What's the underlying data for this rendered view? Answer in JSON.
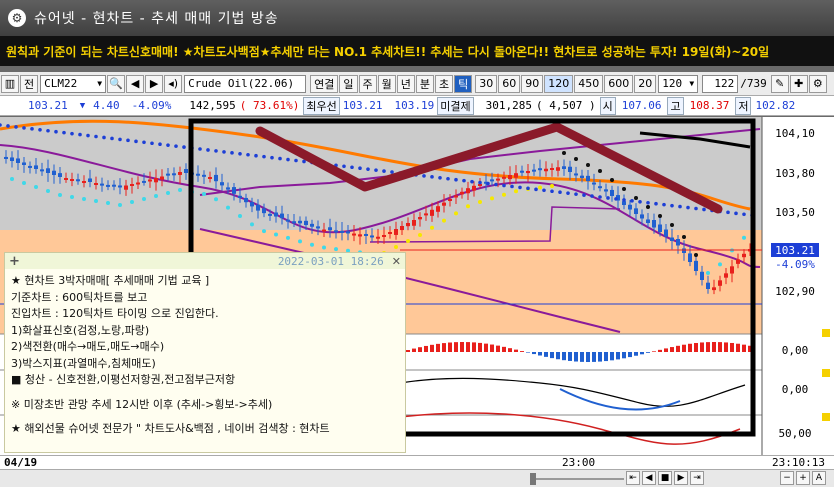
{
  "window": {
    "title": "슈어넷 - 현차트 - 추세 매매 기법 방송"
  },
  "banner": {
    "text": "원칙과 기준이 되는 차트신호매매! ★차트도사백점★추세만 타는 NO.1 추세차트!! 추세는 다시 돌아온다!! 현차트로 성공하는 투자! 19일(화)~20일"
  },
  "toolbar": {
    "mode_label": "전",
    "symbol": "CLM22",
    "search_icon": "magnifier-icon",
    "symbol_name": "Crude Oil(22.06)",
    "period_buttons": [
      "연결",
      "일",
      "주",
      "월",
      "년",
      "분",
      "초",
      "틱"
    ],
    "active_period": "틱",
    "tick_buttons": [
      "30",
      "60",
      "90",
      "120",
      "450",
      "600",
      "20"
    ],
    "selected_tick": "120",
    "interval_value": "120",
    "page_value": "122",
    "page_total": "/739"
  },
  "quote": {
    "price": "103.21",
    "arrow": "▼",
    "change": "4.40",
    "change_pct": "-4.09%",
    "volume": "142,595",
    "volume_pct": "( 73.61%)",
    "best_ask_label": "최우선",
    "best_ask": "103.21",
    "best_bid": "103.19",
    "open_interest_label": "미결제",
    "open_interest": "301,285",
    "oi_change": "( 4,507 )",
    "open_label": "시",
    "open": "107.06",
    "high_label": "고",
    "high": "108.37",
    "low_label": "저",
    "low": "102.82"
  },
  "chart": {
    "price_axis": [
      "104,10",
      "103,80",
      "103,50",
      "103,21",
      "-4.09%",
      "102,90"
    ],
    "current_price": "103.21",
    "current_pct": "-4.09%",
    "panel_labels": [
      "0,00",
      "0,00",
      "50,00"
    ],
    "colors": {
      "bg_upper": "#c8c8c8",
      "bg_lower": "#ffc898",
      "up": "#e8201c",
      "down": "#2060d0",
      "box": "#000000",
      "zigzag": "#8b1a2a"
    }
  },
  "note": {
    "date": "2022-03-01 18:26",
    "plus": "+",
    "close": "✕",
    "lines": [
      "★ 현차트  3박자매매[ 추세매매 기법 교육 ]",
      "기준차트 : 600틱차트를 보고",
      "진입차트 : 120틱차트 타이밍 으로 진입한다.",
      "1)화살표신호(검정,노랑,파랑)",
      "2)색전환(매수→매도,매도→매수)",
      "3)박스지표(과열매수,침체매도)",
      "■ 청산 - 신호전환,이평선저항권,전고점부근저항",
      "",
      "※ 미장초반 관망 추세 12시반 이후 (추세->횡보->추세)",
      "",
      "★ 해외선물 슈어넷 전문가 \" 차트도사&백점 , 네이버 검색창 : 현차트"
    ]
  },
  "time_axis": {
    "left_date": "04/19",
    "mid_time": "23:00",
    "right_time": "23:10:13"
  },
  "statusbar": {
    "buttons": [
      "⇤",
      "◀",
      "■",
      "▶",
      "⇥"
    ],
    "right_buttons": [
      "−",
      "+",
      "A"
    ]
  }
}
